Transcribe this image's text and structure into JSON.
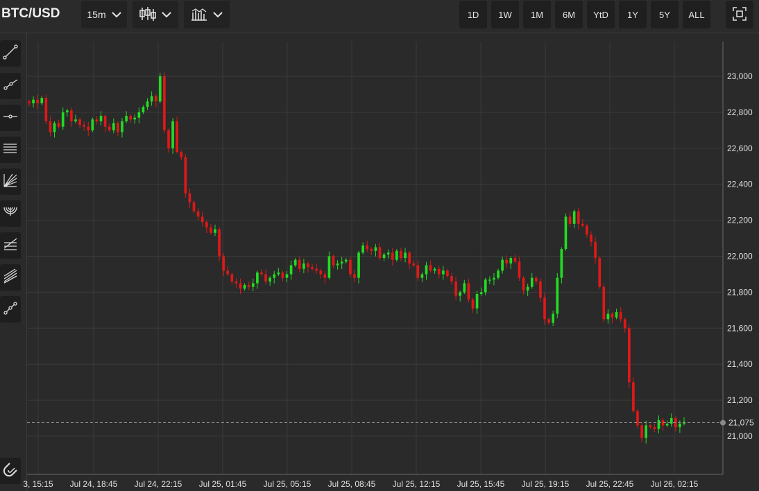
{
  "header": {
    "symbol": "BTC/USD",
    "interval": "15m",
    "ranges": [
      "1D",
      "1W",
      "1M",
      "6M",
      "YtD",
      "1Y",
      "5Y",
      "ALL"
    ]
  },
  "sidebar": {
    "tools": [
      "trend-line-icon",
      "ray-icon",
      "horizontal-line-icon",
      "parallel-channel-icon",
      "fib-fan-icon",
      "fib-arc-icon",
      "fib-retracement-icon",
      "pitchfork-icon",
      "path-icon",
      "magnet-icon"
    ]
  },
  "colors": {
    "up": "#22dd22",
    "down": "#e01818",
    "grid": "#3a3a3a",
    "background": "#2a2a2a"
  },
  "chart_data": {
    "type": "candlestick",
    "y_ticks": [
      "23,000",
      "22,800",
      "22,600",
      "22,400",
      "22,200",
      "22,000",
      "21,800",
      "21,600",
      "21,400",
      "21,200",
      "21,000"
    ],
    "y_tick_values": [
      23000,
      22800,
      22600,
      22400,
      22200,
      22000,
      21800,
      21600,
      21400,
      21200,
      21000
    ],
    "ylim": [
      20800,
      23200
    ],
    "x_ticks": [
      "3, 15:15",
      "Jul 24, 18:45",
      "Jul 24, 22:15",
      "Jul 25, 01:45",
      "Jul 25, 05:15",
      "Jul 25, 08:45",
      "Jul 25, 12:15",
      "Jul 25, 15:45",
      "Jul 25, 19:15",
      "Jul 25, 22:45",
      "Jul 26, 02:15"
    ],
    "last_price": 21075,
    "last_price_label": "21,075",
    "closes": [
      22850,
      22870,
      22850,
      22880,
      22750,
      22690,
      22740,
      22720,
      22800,
      22810,
      22750,
      22760,
      22730,
      22720,
      22700,
      22760,
      22750,
      22780,
      22720,
      22700,
      22740,
      22690,
      22750,
      22780,
      22760,
      22770,
      22800,
      22830,
      22860,
      22890,
      22860,
      23000,
      22700,
      22600,
      22750,
      22580,
      22550,
      22350,
      22300,
      22250,
      22220,
      22190,
      22160,
      22130,
      22150,
      22000,
      21920,
      21900,
      21860,
      21850,
      21820,
      21840,
      21830,
      21850,
      21910,
      21900,
      21860,
      21880,
      21900,
      21910,
      21880,
      21900,
      21950,
      21980,
      21930,
      21960,
      21940,
      21930,
      21920,
      21900,
      21880,
      22000,
      21950,
      21960,
      21970,
      21980,
      21900,
      21880,
      22020,
      22060,
      22040,
      22030,
      22050,
      21990,
      22010,
      22020,
      21980,
      22030,
      21990,
      22020,
      21960,
      21950,
      21880,
      21900,
      21950,
      21920,
      21930,
      21900,
      21920,
      21890,
      21860,
      21780,
      21800,
      21850,
      21760,
      21710,
      21790,
      21800,
      21870,
      21870,
      21880,
      21920,
      21980,
      21960,
      21990,
      21970,
      21880,
      21810,
      21830,
      21880,
      21860,
      21770,
      21650,
      21630,
      21680,
      21880,
      22040,
      22220,
      22180,
      22250,
      22180,
      22170,
      22120,
      22080,
      21990,
      21830,
      21650,
      21680,
      21660,
      21690,
      21650,
      21600,
      21300,
      21140,
      21060,
      20990,
      21060,
      21050,
      21040,
      21090,
      21060,
      21070,
      21100,
      21050,
      21070,
      21080
    ]
  }
}
